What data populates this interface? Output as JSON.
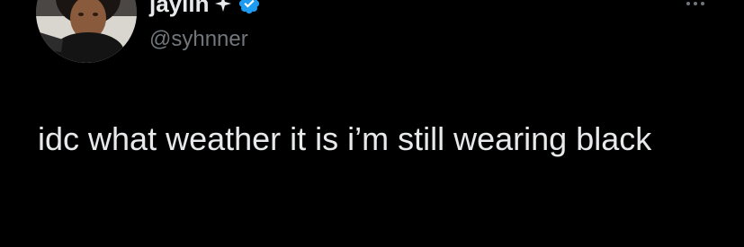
{
  "author": {
    "display_name": "jaylin",
    "handle": "@syhnner",
    "badge_icon": "sparkle-icon",
    "verified_icon": "verified-badge-icon",
    "verified_color": "#1d9bf0"
  },
  "tweet": {
    "text": "idc what weather it is i’m still wearing black"
  },
  "menu": {
    "icon": "more-options-icon"
  },
  "colors": {
    "background": "#000000",
    "primary_text": "#e7e9ea",
    "secondary_text": "#71767b"
  }
}
